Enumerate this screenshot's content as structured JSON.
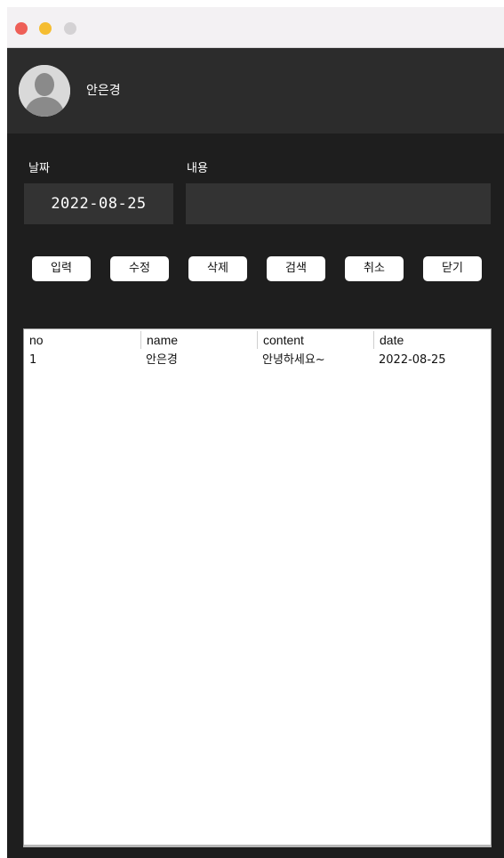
{
  "profile": {
    "name": "안은경",
    "avatar_icon": "default-user-icon"
  },
  "form": {
    "date_label": "날짜",
    "content_label": "내용",
    "date_value": "2022-08-25",
    "content_value": ""
  },
  "buttons": {
    "insert": "입력",
    "edit": "수정",
    "delete": "삭제",
    "search": "검색",
    "cancel": "취소",
    "close": "닫기"
  },
  "table": {
    "headers": [
      "no",
      "name",
      "content",
      "date"
    ],
    "rows": [
      [
        "1",
        "안은경",
        "안녕하세요~",
        "2022-08-25"
      ]
    ]
  },
  "colors": {
    "window_bg": "#1e1e1e",
    "header_bg": "#2c2c2c",
    "field_bg": "#333333",
    "close_light": "#ee5f57",
    "minimize_light": "#f5bd31",
    "maximize_light": "#d4d2d4"
  }
}
